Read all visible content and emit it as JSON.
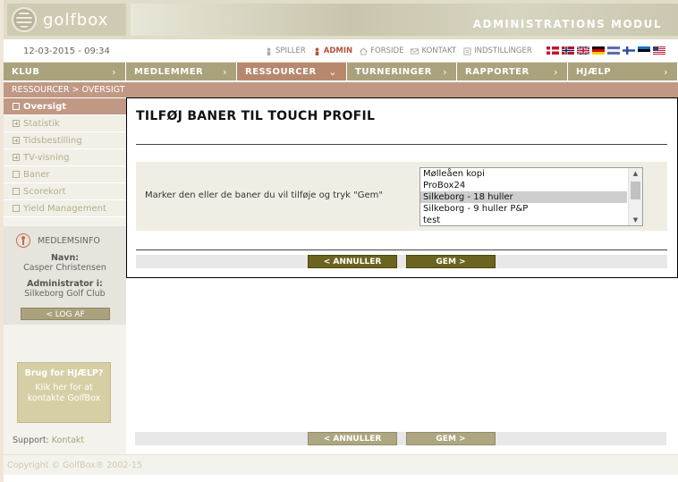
{
  "app": {
    "logo_text": "golfbox",
    "module_title": "ADMINISTRATIONS MODUL"
  },
  "toolbar": {
    "datetime": "12-03-2015 - 09:34",
    "links": [
      {
        "label": "SPILLER",
        "icon": "person-icon",
        "active": false
      },
      {
        "label": "ADMIN",
        "icon": "person-icon",
        "active": true
      },
      {
        "label": "FORSIDE",
        "icon": "home-icon",
        "active": false
      },
      {
        "label": "KONTAKT",
        "icon": "mail-icon",
        "active": false
      },
      {
        "label": "INDSTILLINGER",
        "icon": "settings-icon",
        "active": false
      }
    ],
    "flags": [
      "denmark-flag",
      "norway-flag",
      "uk-flag",
      "germany-flag",
      "netherlands-flag",
      "finland-flag",
      "estonia-flag",
      "usa-flag"
    ]
  },
  "mainnav": [
    {
      "label": "KLUB",
      "icon": "chevron-right-icon"
    },
    {
      "label": "MEDLEMMER",
      "icon": "chevron-right-icon"
    },
    {
      "label": "RESSOURCER",
      "icon": "chevron-down-icon",
      "active": true
    },
    {
      "label": "TURNERINGER",
      "icon": "chevron-right-icon"
    },
    {
      "label": "RAPPORTER",
      "icon": "chevron-right-icon"
    },
    {
      "label": "HJÆLP",
      "icon": "chevron-right-icon"
    }
  ],
  "breadcrumb": "RESSOURCER > OVERSIGT",
  "sidebar": {
    "items": [
      {
        "label": "Oversigt",
        "type": "box",
        "active": true
      },
      {
        "label": "Statistik",
        "type": "plus"
      },
      {
        "label": "Tidsbestilling",
        "type": "plus"
      },
      {
        "label": "TV-visning",
        "type": "plus"
      },
      {
        "label": "Baner",
        "type": "box"
      },
      {
        "label": "Scorekort",
        "type": "box"
      },
      {
        "label": "Yield Management",
        "type": "box"
      }
    ],
    "memberinfo": {
      "title": "MEDLEMSINFO",
      "name_label": "Navn:",
      "name": "Casper Christensen",
      "role_label": "Administrator i:",
      "club": "Silkeborg Golf Club",
      "logout": "< LOG AF"
    },
    "help": {
      "title": "Brug for HJÆLP?",
      "line1": "Klik her for at",
      "line2": "kontakte GolfBox"
    },
    "support_label": "Support:",
    "support_link": "Kontakt"
  },
  "main": {
    "title": "TILFØJ BANER TIL TOUCH PROFIL",
    "instruction": "Marker den eller de baner du vil tilføje og tryk \"Gem\"",
    "courses": [
      "Mølleåen kopi",
      "ProBox24",
      "Silkeborg - 18 huller",
      "Silkeborg - 9 huller P&P",
      "test"
    ],
    "selected_course": "Silkeborg - 18 huller",
    "cancel_label": "< ANNULLER",
    "save_label": "GEM >"
  },
  "footer": {
    "copyright": "Copyright © GolfBox® 2002-15"
  },
  "colors": {
    "nav": "#a9a27d",
    "active": "#b8886e",
    "button_dark": "#6b6420",
    "button_light": "#aca681"
  }
}
